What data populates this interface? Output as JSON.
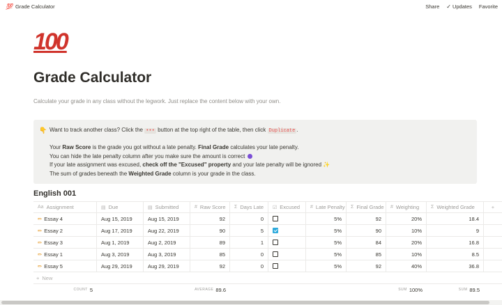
{
  "topbar": {
    "page_icon": "💯",
    "breadcrumb": "Grade Calculator",
    "share": "Share",
    "updates": "Updates",
    "favorite": "Favorite"
  },
  "page": {
    "icon": "100",
    "title": "Grade Calculator",
    "description": "Calculate your grade in any class without the legwork. Just replace the content below with your own."
  },
  "callout": {
    "icon": "👇",
    "line1_pre": "Want to track another class? Click the",
    "line1_code": "•••",
    "line1_mid": "button at the top right of the table, then click",
    "line1_code2": "Duplicate",
    "line1_end": ".",
    "line2_a": "Your",
    "line2_b": "Raw Score",
    "line2_c": "is the grade you got without a late penalty.",
    "line2_d": "Final Grade",
    "line2_e": "calculates your late penalty.",
    "line3": "You can hide the late penalty column after you make sure the amount is correct",
    "line4_a": "If your late assignment was excused,",
    "line4_b": "check off the \"Excused\" property",
    "line4_c": "and your late penalty will be ignored",
    "line4_sparkle": "✨",
    "line5_a": "The sum of grades beneath the",
    "line5_b": "Weighted Grade",
    "line5_c": "column is your grade in the class."
  },
  "database": {
    "title": "English 001",
    "columns": [
      {
        "icon": "Aa",
        "label": "Assignment"
      },
      {
        "icon": "▤",
        "label": "Due"
      },
      {
        "icon": "▤",
        "label": "Submitted"
      },
      {
        "icon": "#",
        "label": "Raw Score"
      },
      {
        "icon": "Σ",
        "label": "Days Late"
      },
      {
        "icon": "☑",
        "label": "Excused"
      },
      {
        "icon": "#",
        "label": "Late Penalty"
      },
      {
        "icon": "Σ",
        "label": "Final Grade"
      },
      {
        "icon": "#",
        "label": "Weighting"
      },
      {
        "icon": "Σ",
        "label": "Weighted Grade"
      }
    ],
    "add_column": "+",
    "rows": [
      {
        "assignment": "Essay 4",
        "due": "Aug 15, 2019",
        "submitted": "Aug 15, 2019",
        "raw": "92",
        "days_late": "0",
        "excused": false,
        "penalty": "5%",
        "final": "92",
        "weighting": "20%",
        "weighted": "18.4"
      },
      {
        "assignment": "Essay 2",
        "due": "Aug 17, 2019",
        "submitted": "Aug 22, 2019",
        "raw": "90",
        "days_late": "5",
        "excused": true,
        "penalty": "5%",
        "final": "90",
        "weighting": "10%",
        "weighted": "9"
      },
      {
        "assignment": "Essay 3",
        "due": "Aug 1, 2019",
        "submitted": "Aug 2, 2019",
        "raw": "89",
        "days_late": "1",
        "excused": false,
        "penalty": "5%",
        "final": "84",
        "weighting": "20%",
        "weighted": "16.8"
      },
      {
        "assignment": "Essay 1",
        "due": "Aug 3, 2019",
        "submitted": "Aug 3, 2019",
        "raw": "85",
        "days_late": "0",
        "excused": false,
        "penalty": "5%",
        "final": "85",
        "weighting": "10%",
        "weighted": "8.5"
      },
      {
        "assignment": "Essay 5",
        "due": "Aug 29, 2019",
        "submitted": "Aug 29, 2019",
        "raw": "92",
        "days_late": "0",
        "excused": false,
        "penalty": "5%",
        "final": "92",
        "weighting": "40%",
        "weighted": "36.8"
      }
    ],
    "new_label": "New",
    "footer": {
      "count_label": "COUNT",
      "count_value": "5",
      "average_label": "AVERAGE",
      "average_value": "89.6",
      "sum1_label": "SUM",
      "sum1_value": "100%",
      "sum2_label": "SUM",
      "sum2_value": "89.5"
    }
  }
}
